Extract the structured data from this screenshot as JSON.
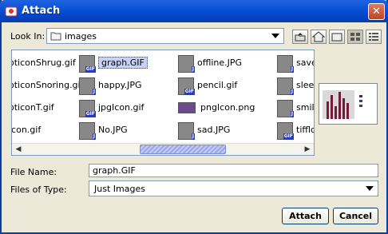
{
  "window": {
    "title": "Attach",
    "close_symbol": "✕"
  },
  "look_in": {
    "label": "Look In:",
    "value": "images"
  },
  "files": {
    "columns": [
      [
        "oticonShrug.gif",
        "oticonSnoring.gif",
        "oticonT.gif",
        "icon.gif"
      ],
      [
        "graph.GIF",
        "happy.JPG",
        "jpgIcon.gif",
        "No.JPG"
      ],
      [
        "offline.JPG",
        "pencil.gif",
        "pngIcon.png",
        "sad.JPG"
      ],
      [
        "save",
        "sleep",
        "smile",
        "tifflo"
      ]
    ],
    "selected": "graph.GIF",
    "badges": {
      "gif": "GIF",
      "jpg": "J"
    }
  },
  "file_name": {
    "label": "File Name:",
    "value": "graph.GIF"
  },
  "file_type": {
    "label": "Files of Type:",
    "value": "Just Images"
  },
  "buttons": {
    "attach": "Attach",
    "cancel": "Cancel"
  },
  "accent_color": "#0a3fa8"
}
